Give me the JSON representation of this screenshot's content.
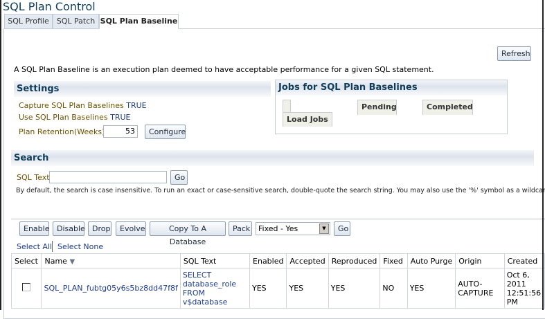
{
  "title": "SQL Plan Control",
  "tabs": [
    {
      "label": "SQL Profile"
    },
    {
      "label": "SQL Patch"
    },
    {
      "label": "SQL Plan Baseline",
      "selected": true
    }
  ],
  "refresh_label": "Refresh",
  "description": "A SQL Plan Baseline is an execution plan deemed to have acceptable performance for a given SQL statement.",
  "settings": {
    "title": "Settings",
    "capture_label": "Capture SQL Plan Baselines",
    "capture_value": "TRUE",
    "use_label": "Use SQL Plan Baselines",
    "use_value": "TRUE",
    "retention_label": "Plan Retention(Weeks)",
    "retention_value": "53",
    "configure_label": "Configure"
  },
  "jobs": {
    "title": "Jobs for SQL Plan Baselines",
    "load_jobs": "Load Jobs",
    "pending": "Pending",
    "completed": "Completed"
  },
  "search": {
    "title": "Search",
    "sql_text_label": "SQL Text",
    "sql_text_value": "",
    "go_label": "Go",
    "hint": "By default, the search is case insensitive. To run an exact or case-sensitive search, double-quote the search string. You may also use the '%' symbol as a wildcard."
  },
  "actions": {
    "enable": "Enable",
    "disable": "Disable",
    "drop": "Drop",
    "evolve": "Evolve",
    "copy": "Copy To A Database",
    "pack": "Pack",
    "filter_value": "Fixed - Yes",
    "go": "Go"
  },
  "select_all": "Select All",
  "select_none": "Select None",
  "table": {
    "headers": [
      "Select",
      "Name",
      "SQL Text",
      "Enabled",
      "Accepted",
      "Reproduced",
      "Fixed",
      "Auto Purge",
      "Origin",
      "Created"
    ],
    "rows": [
      {
        "checked": false,
        "name": "SQL_PLAN_fubtg05y6s5bz8dd47f8f",
        "sql_text_1": "SELECT database_role",
        "sql_text_2": "FROM v$database",
        "enabled": "YES",
        "accepted": "YES",
        "reproduced": "YES",
        "fixed": "NO",
        "auto_purge": "YES",
        "origin": "AUTO-CAPTURE",
        "created_1": "Oct 6,",
        "created_2": "2011",
        "created_3": "12:51:56",
        "created_4": "PM"
      }
    ]
  }
}
